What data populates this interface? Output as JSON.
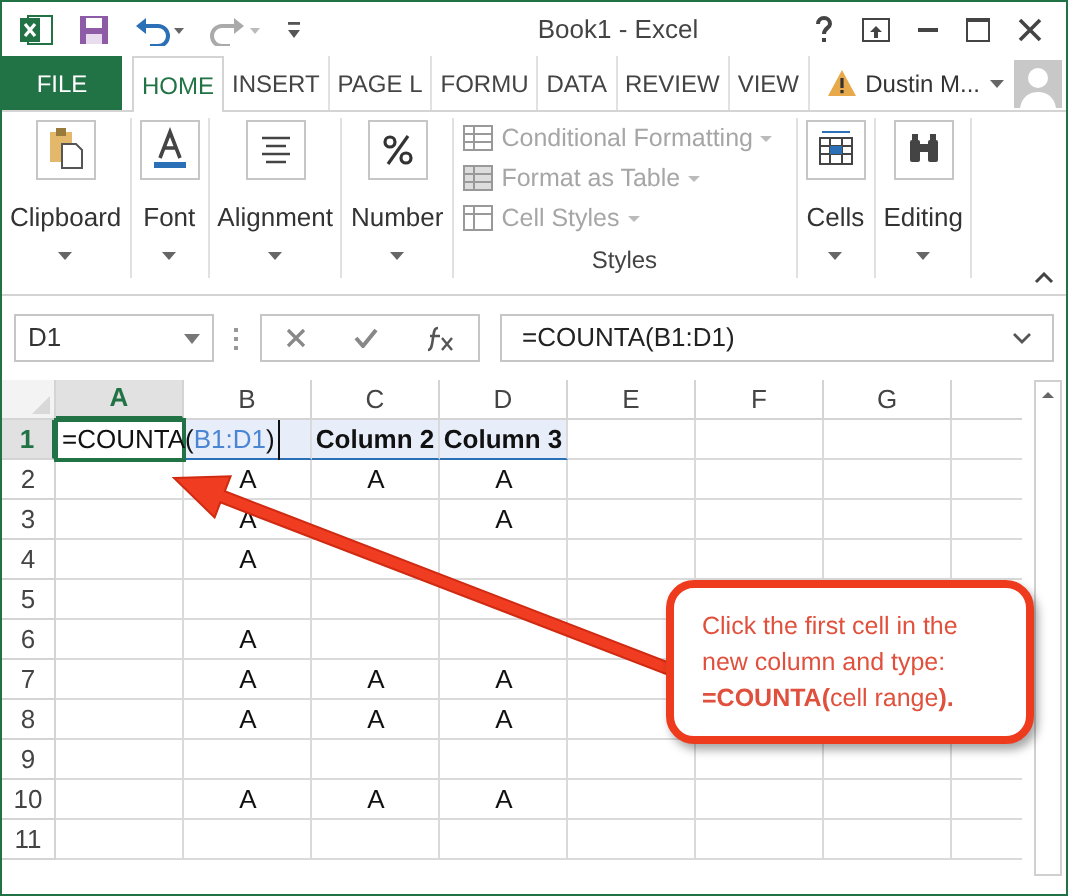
{
  "window": {
    "title": "Book1 - Excel"
  },
  "tabs": [
    {
      "label": "FILE",
      "kind": "file",
      "selected": false
    },
    {
      "label": "HOME",
      "kind": "tab",
      "selected": true
    },
    {
      "label": "INSERT",
      "kind": "tab",
      "selected": false
    },
    {
      "label": "PAGE L",
      "kind": "tab",
      "selected": false
    },
    {
      "label": "FORMU",
      "kind": "tab",
      "selected": false
    },
    {
      "label": "DATA",
      "kind": "tab",
      "selected": false
    },
    {
      "label": "REVIEW",
      "kind": "tab",
      "selected": false
    },
    {
      "label": "VIEW",
      "kind": "tab",
      "selected": false
    }
  ],
  "user": {
    "name": "Dustin M..."
  },
  "ribbon_groups": [
    {
      "kind": "big",
      "label": "Clipboard"
    },
    {
      "kind": "big",
      "label": "Font"
    },
    {
      "kind": "big",
      "label": "Alignment"
    },
    {
      "kind": "big",
      "label": "Number"
    },
    {
      "kind": "styles",
      "label": "Styles",
      "items": [
        {
          "label": "Conditional Formatting",
          "disabled": true
        },
        {
          "label": "Format as Table",
          "disabled": true
        },
        {
          "label": "Cell Styles",
          "disabled": true
        }
      ]
    },
    {
      "kind": "big",
      "label": "Cells"
    },
    {
      "kind": "big",
      "label": "Editing"
    }
  ],
  "formula_bar": {
    "name_box": "D1",
    "formula": "=COUNTA(B1:D1)"
  },
  "sheet": {
    "columns": [
      {
        "label": "A",
        "selected": true
      },
      {
        "label": "B",
        "selected": false
      },
      {
        "label": "C",
        "selected": false
      },
      {
        "label": "D",
        "selected": false
      },
      {
        "label": "E",
        "selected": false
      },
      {
        "label": "F",
        "selected": false
      },
      {
        "label": "G",
        "selected": false
      }
    ],
    "rows": [
      {
        "number": "1",
        "selected": true,
        "cells": [
          {
            "parts": [
              "=COUNTA(",
              "B1:D1",
              ")"
            ],
            "editing": true
          },
          {
            "text": "",
            "highlighted": true
          },
          {
            "text": "Column 2",
            "highlighted": true
          },
          {
            "text": "Column 3",
            "highlighted": true
          }
        ]
      },
      {
        "number": "2",
        "selected": false,
        "cells": [
          "",
          "A",
          "A",
          "A"
        ]
      },
      {
        "number": "3",
        "selected": false,
        "cells": [
          "",
          "A",
          "",
          "A"
        ]
      },
      {
        "number": "4",
        "selected": false,
        "cells": [
          "",
          "A",
          "",
          ""
        ]
      },
      {
        "number": "5",
        "selected": false,
        "cells": [
          "",
          "",
          "",
          ""
        ]
      },
      {
        "number": "6",
        "selected": false,
        "cells": [
          "",
          "A",
          "",
          ""
        ]
      },
      {
        "number": "7",
        "selected": false,
        "cells": [
          "",
          "A",
          "A",
          "A"
        ]
      },
      {
        "number": "8",
        "selected": false,
        "cells": [
          "",
          "A",
          "A",
          "A"
        ]
      },
      {
        "number": "9",
        "selected": false,
        "cells": [
          "",
          "",
          "",
          ""
        ]
      },
      {
        "number": "10",
        "selected": false,
        "cells": [
          "",
          "A",
          "A",
          "A"
        ]
      },
      {
        "number": "11",
        "selected": false,
        "cells": [
          "",
          "",
          "",
          ""
        ]
      }
    ]
  },
  "callout": {
    "text": "Click the first cell in the new column and type: **=COUNTA(**cell range**).**"
  }
}
